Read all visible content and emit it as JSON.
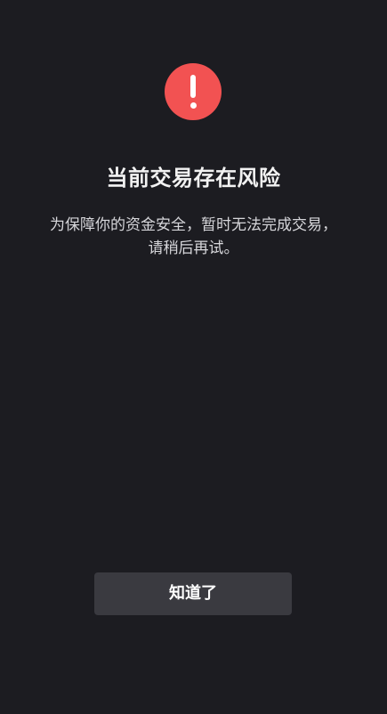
{
  "dialog": {
    "icon": "exclamation-circle-icon",
    "icon_color": "#f25252",
    "title": "当前交易存在风险",
    "message_line1": "为保障你的资金安全，暂时无法完成交易，",
    "message_line2": "请稍后再试。",
    "confirm_label": "知道了"
  },
  "colors": {
    "background": "#1c1c21",
    "button_background": "#3a3a40",
    "text_primary": "#ffffff"
  }
}
